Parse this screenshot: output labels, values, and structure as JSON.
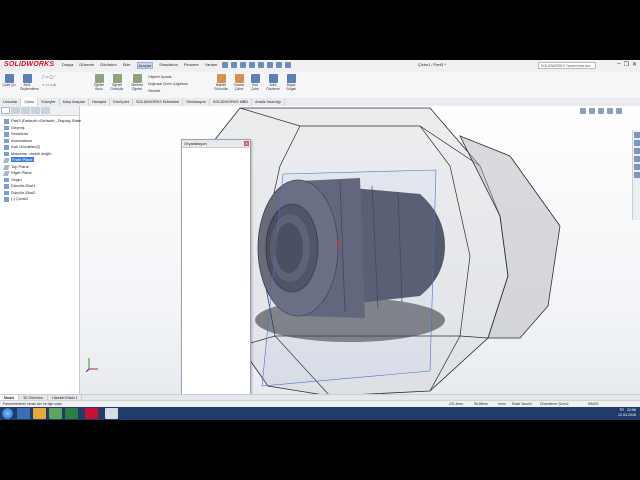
{
  "app": {
    "logo": "SOLIDWORKS",
    "menus": [
      "Dosya",
      "Düzenle",
      "Görünüm",
      "Ekle",
      "Araçlar",
      "Simulation",
      "Pencere",
      "Yardım"
    ],
    "active_menu": "Araçlar",
    "document_title": "Çizim1 / Part3 *",
    "help_search": "SOLIDWORKS Yardımı'nda Ara",
    "window_controls": [
      "–",
      "❐",
      "✕"
    ]
  },
  "ribbon": {
    "buttons": [
      {
        "label": "Çizim Çiz",
        "icon": "sketch-icon"
      },
      {
        "label": "Akıllı Ölçülendirme",
        "icon": "smart-dimension-icon"
      },
      {
        "label": "Öğeleri Budu",
        "icon": "trim-entities-icon"
      },
      {
        "label": "Öğeleri Dönüştür",
        "icon": "convert-entities-icon"
      },
      {
        "label": "Öteleme Öğeleri",
        "icon": "offset-entities-icon"
      },
      {
        "label": "İlişkileri Görüntüle",
        "icon": "display-relations-icon"
      },
      {
        "label": "Onarım Çizimi",
        "icon": "repair-sketch-icon"
      },
      {
        "label": "Hızlı Çizim",
        "icon": "rapid-sketch-icon"
      },
      {
        "label": "Anlık Önizleme",
        "icon": "instant2d-icon"
      },
      {
        "label": "Boyalı Gölgeli",
        "icon": "shaded-sketch-icon"
      }
    ],
    "small_items": [
      "Objeleri Aynala",
      "Doğrusal Çizim Çoğaltma",
      "Hareket"
    ]
  },
  "command_tabs": [
    "Unsurlar",
    "Çizim",
    "Yüzeyler",
    "Kalıp Araçları",
    "Hesapla",
    "DimXpert",
    "SOLIDWORKS Eklentileri",
    "Simülasyon",
    "SOLIDWORKS MBD",
    "Analiz Hazırlığı"
  ],
  "active_tab": "Çizim",
  "feature_tree": [
    {
      "label": "Part3 (Default<<Default>_Display State",
      "kind": "part"
    },
    {
      "label": "Geçmiş",
      "kind": "item"
    },
    {
      "label": "Sensörler",
      "kind": "item"
    },
    {
      "label": "Annotations",
      "kind": "item"
    },
    {
      "label": "Katı Gövdeler(2)",
      "kind": "item"
    },
    {
      "label": "Malzeme <belirli değil>",
      "kind": "item"
    },
    {
      "label": "Front Plane",
      "kind": "plane",
      "selected": true
    },
    {
      "label": "Top Plane",
      "kind": "plane"
    },
    {
      "label": "Right Plane",
      "kind": "plane"
    },
    {
      "label": "Origin",
      "kind": "item"
    },
    {
      "label": "Döndür-Ekst1",
      "kind": "item"
    },
    {
      "label": "Döndür-Ekst2",
      "kind": "item"
    },
    {
      "label": "(-) Çizim2",
      "kind": "item"
    }
  ],
  "orientation_panel": {
    "title": "Oryantasyon",
    "close": "✕"
  },
  "bottom_tabs": [
    "Model",
    "3D Görünüm",
    "Hareket Etüdü 1"
  ],
  "active_bottom_tab": "Model",
  "status": {
    "left": "Parametrelerini almak için bir öğe seçin",
    "coords": [
      "-231,6mm",
      "96,88mm",
      "0mm"
    ],
    "state": "Eksik Tanımlı",
    "edit": "Düzenleme Çizim2",
    "units": "MMGS"
  },
  "taskbar": {
    "time": "22:56",
    "date": "12.04.2016",
    "lang": "TR"
  },
  "colors": {
    "ribbon": "#f5f6f8",
    "selection": "#3d7bd6",
    "taskbar": "#1f3c6a",
    "solid_body": "#5a5d6a",
    "transparent_body": "#b8bbc2"
  }
}
